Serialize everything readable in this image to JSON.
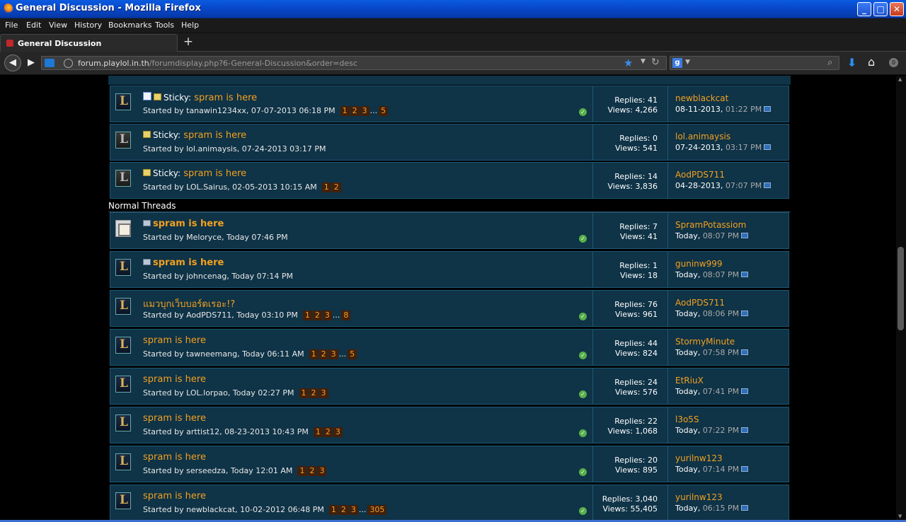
{
  "window": {
    "title": "General Discussion - Mozilla Firefox",
    "btn_min": "_",
    "btn_max": "□",
    "btn_close": "✕"
  },
  "menu": {
    "file": "File",
    "edit": "Edit",
    "view": "View",
    "history": "History",
    "bookmarks": "Bookmarks",
    "tools": "Tools",
    "help": "Help"
  },
  "tab": {
    "label": "General Discussion",
    "new_tab": "+"
  },
  "nav": {
    "url_host": "forum.playlol.in.th",
    "url_path": "/forumdisplay.php?6-General-Discussion&order=desc",
    "back": "◀",
    "forward": "▶"
  },
  "search": {
    "engine": "g",
    "placeholder": ""
  },
  "sections": {
    "normal": "Normal Threads"
  },
  "labels": {
    "sticky": "Sticky:",
    "started_by": "Started by",
    "replies": "Replies:",
    "views": "Views:",
    "ellipsis": "..."
  },
  "sticky_threads": [
    {
      "title": "spram is here",
      "meta": "tanawin1234xx, 07-07-2013 06:18 PM",
      "pages": [
        "1",
        "2",
        "3"
      ],
      "last_page": "5",
      "replies": "41",
      "views": "4,266",
      "last_user": "newblackcat",
      "last_date": "08-11-2013,",
      "last_time": "01:22 PM"
    },
    {
      "title": "spram is here",
      "meta": "lol.animaysis, 07-24-2013 03:17 PM",
      "pages": [],
      "last_page": "",
      "replies": "0",
      "views": "541",
      "last_user": "lol.animaysis",
      "last_date": "07-24-2013,",
      "last_time": "03:17 PM"
    },
    {
      "title": "spram is here",
      "meta": "LOL.Sairus, 02-05-2013 10:15 AM",
      "pages": [
        "1",
        "2"
      ],
      "last_page": "",
      "replies": "14",
      "views": "3,836",
      "last_user": "AodPDS711",
      "last_date": "04-28-2013,",
      "last_time": "07:07 PM"
    }
  ],
  "threads": [
    {
      "title": "spram is here",
      "meta": "Meloryce, Today 07:46 PM",
      "pages": [],
      "last_page": "",
      "replies": "7",
      "views": "41",
      "last_user": "SpramPotassiom",
      "last_date": "Today,",
      "last_time": "08:07 PM"
    },
    {
      "title": "spram is here",
      "meta": "johncenag, Today 07:14 PM",
      "pages": [],
      "last_page": "",
      "replies": "1",
      "views": "18",
      "last_user": "guninw999",
      "last_date": "Today,",
      "last_time": "08:07 PM"
    },
    {
      "title": "แมวบุกเว็บบอร์ดเรอะ!?",
      "meta": "AodPDS711, Today 03:10 PM",
      "pages": [
        "1",
        "2",
        "3"
      ],
      "last_page": "8",
      "replies": "76",
      "views": "961",
      "last_user": "AodPDS711",
      "last_date": "Today,",
      "last_time": "08:06 PM"
    },
    {
      "title": "spram is here",
      "meta": "tawneemang, Today 06:11 AM",
      "pages": [
        "1",
        "2",
        "3"
      ],
      "last_page": "5",
      "replies": "44",
      "views": "824",
      "last_user": "StormyMinute",
      "last_date": "Today,",
      "last_time": "07:58 PM"
    },
    {
      "title": "spram is here",
      "meta": "LOL.lorpao, Today 02:27 PM",
      "pages": [
        "1",
        "2",
        "3"
      ],
      "last_page": "",
      "replies": "24",
      "views": "576",
      "last_user": "EtRiuX",
      "last_date": "Today,",
      "last_time": "07:41 PM"
    },
    {
      "title": "spram is here",
      "meta": "arttist12, 08-23-2013 10:43 PM",
      "pages": [
        "1",
        "2",
        "3"
      ],
      "last_page": "",
      "replies": "22",
      "views": "1,068",
      "last_user": "l3o5S",
      "last_date": "Today,",
      "last_time": "07:22 PM"
    },
    {
      "title": "spram is here",
      "meta": "serseedza, Today 12:01 AM",
      "pages": [
        "1",
        "2",
        "3"
      ],
      "last_page": "",
      "replies": "20",
      "views": "895",
      "last_user": "yurilnw123",
      "last_date": "Today,",
      "last_time": "07:14 PM"
    },
    {
      "title": "spram is here",
      "meta": "newblackcat, 10-02-2012 06:48 PM",
      "pages": [
        "1",
        "2",
        "3"
      ],
      "last_page": "305",
      "replies": "3,040",
      "views": "55,405",
      "last_user": "yurilnw123",
      "last_date": "Today,",
      "last_time": "06:15 PM"
    }
  ],
  "colors": {
    "link": "#f3a120",
    "row_bg": "#0f3347",
    "row_border": "#1c5876",
    "page_bg": "#000000"
  }
}
